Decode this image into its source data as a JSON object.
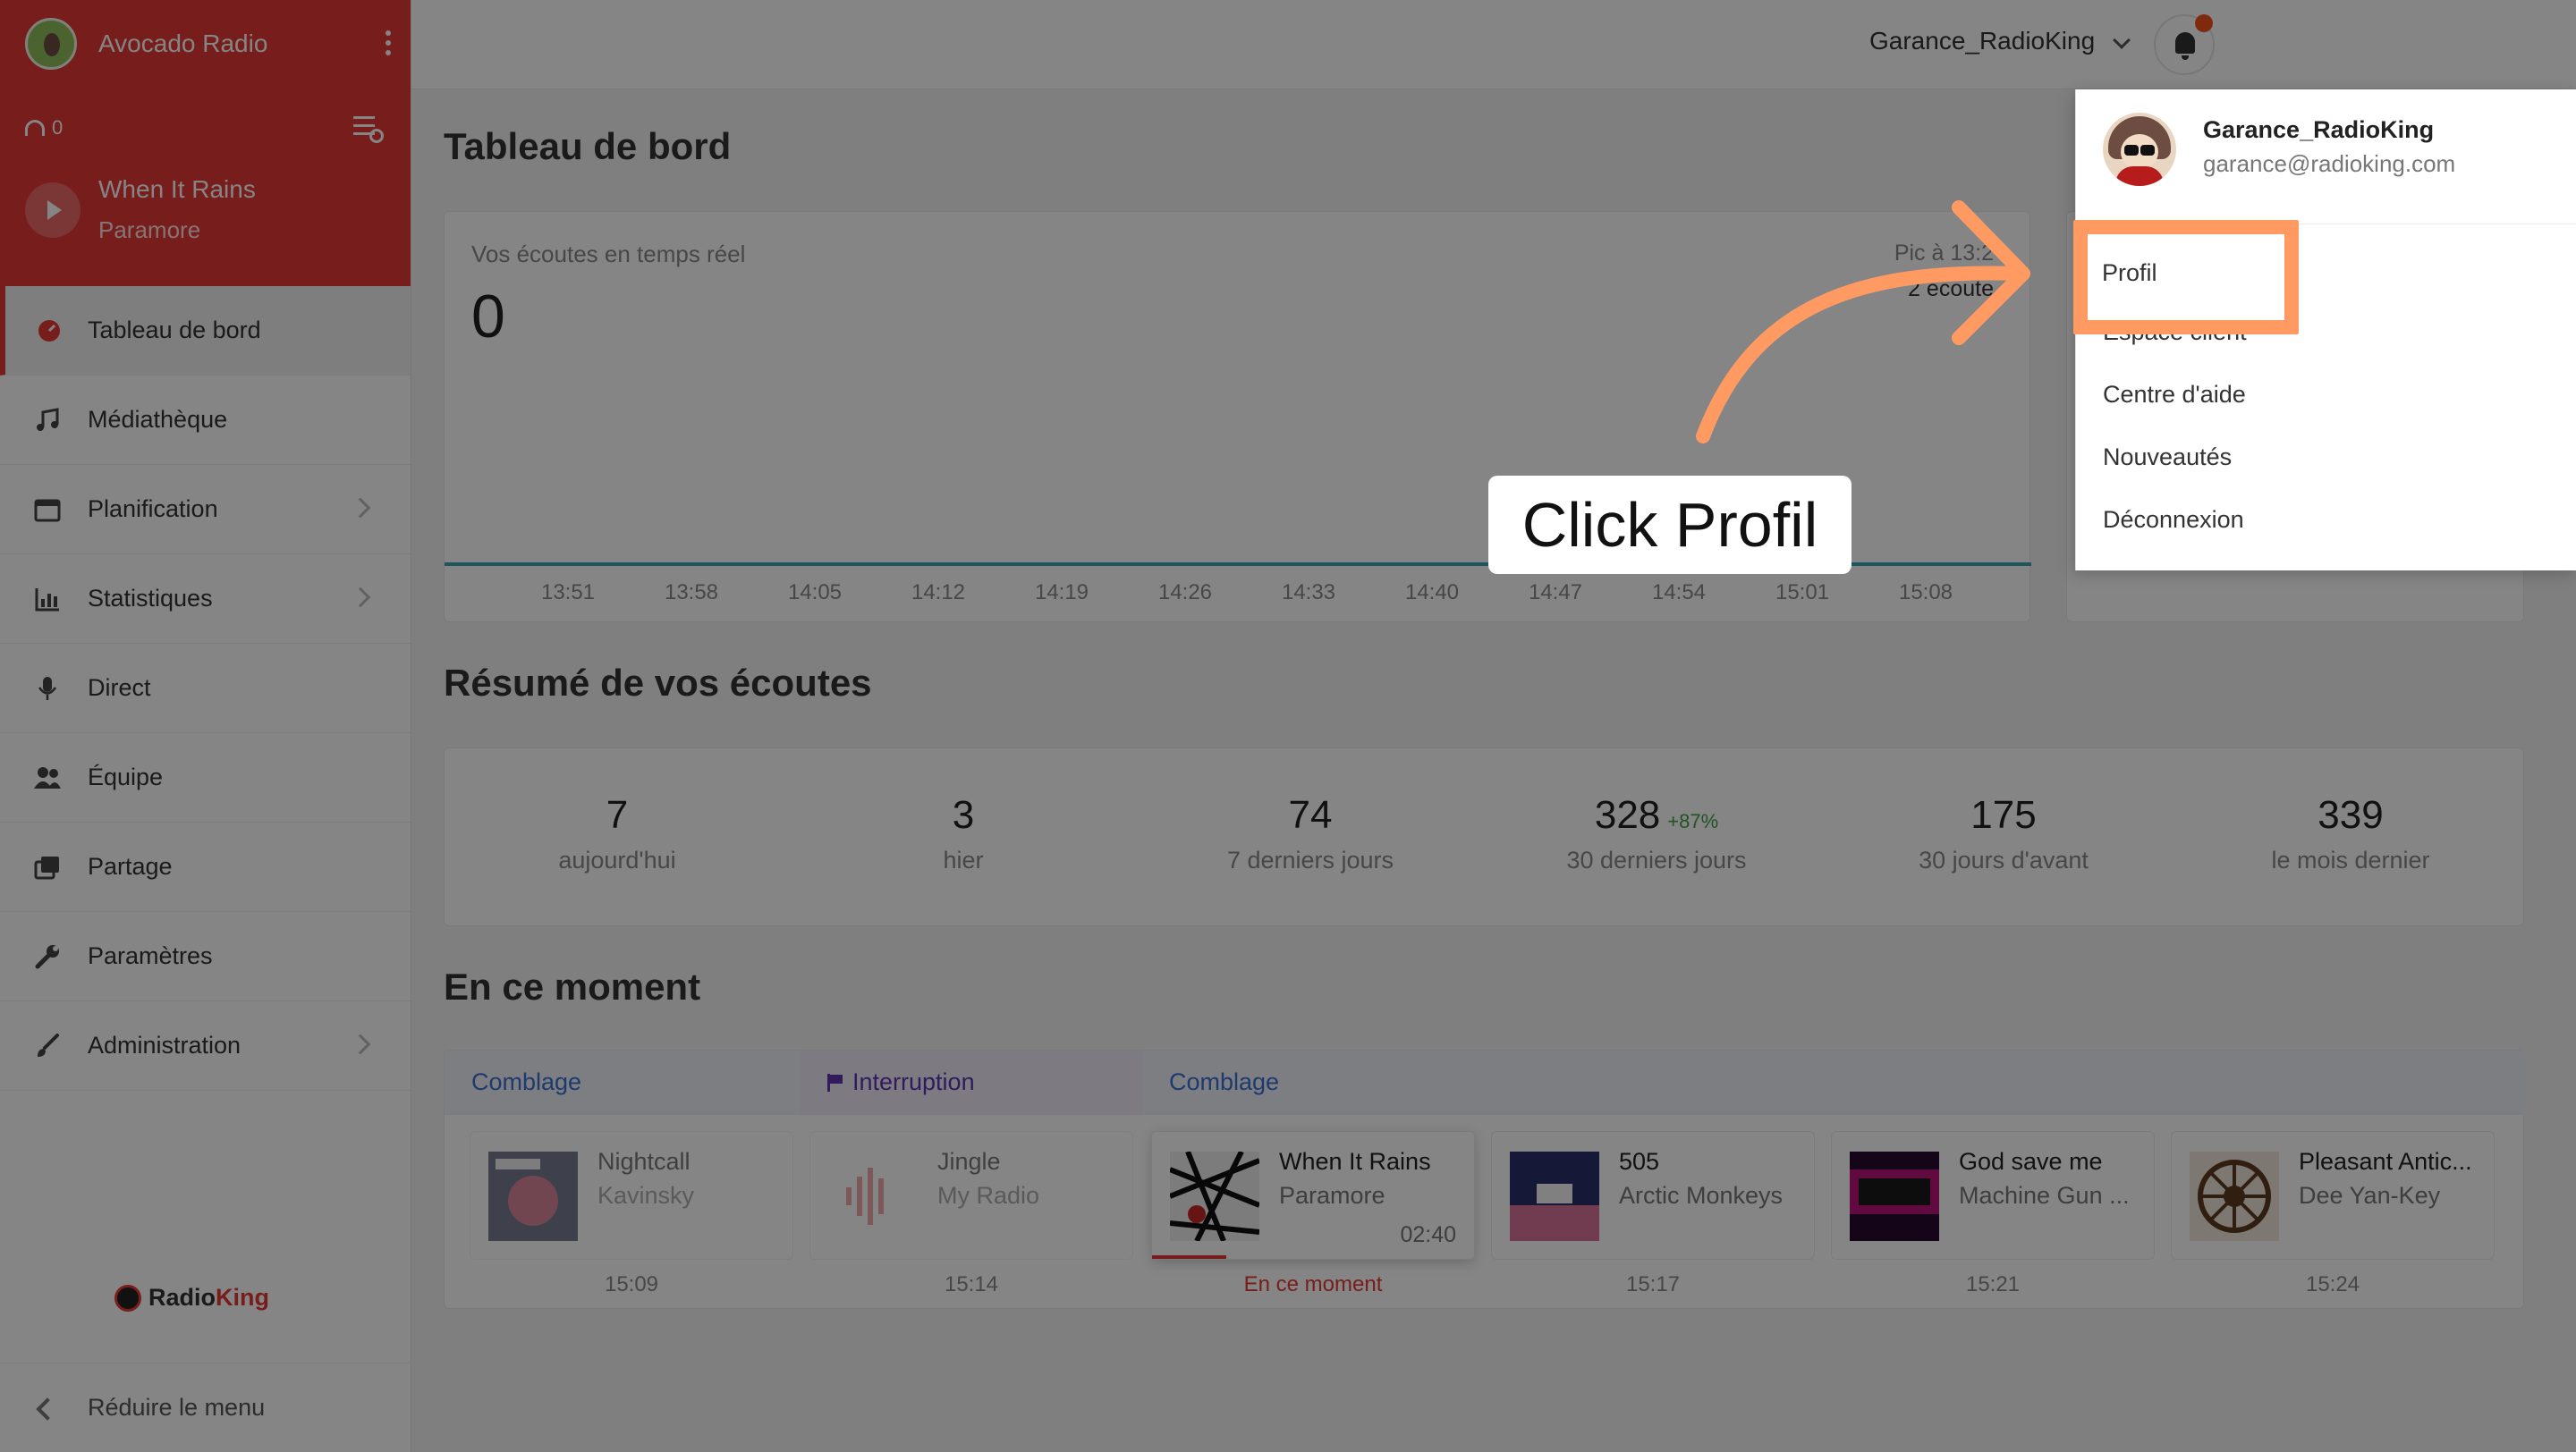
{
  "station": {
    "name": "Avocado Radio"
  },
  "player": {
    "listeners": "0",
    "track_title": "When It Rains",
    "track_artist": "Paramore"
  },
  "nav": [
    {
      "label": "Tableau de bord",
      "icon": "dashboard-icon",
      "active": true
    },
    {
      "label": "Médiathèque",
      "icon": "music-note-icon"
    },
    {
      "label": "Planification",
      "icon": "calendar-icon",
      "submenu": true
    },
    {
      "label": "Statistiques",
      "icon": "chart-icon",
      "submenu": true
    },
    {
      "label": "Direct",
      "icon": "microphone-icon"
    },
    {
      "label": "Équipe",
      "icon": "team-icon"
    },
    {
      "label": "Partage",
      "icon": "share-icon"
    },
    {
      "label": "Paramètres",
      "icon": "wrench-icon"
    },
    {
      "label": "Administration",
      "icon": "brush-icon",
      "submenu": true
    }
  ],
  "brand": {
    "logo_prefix": "Radio",
    "logo_suffix": "King"
  },
  "reduce_menu": "Réduire le menu",
  "topbar": {
    "username": "Garance_RadioKing"
  },
  "dashboard": {
    "title": "Tableau de bord",
    "realtime": {
      "label": "Vos écoutes en temps réel",
      "value": "0",
      "peak_label": "Pic à 13:2",
      "peak_value": "2 écoute",
      "ticks": [
        "13:51",
        "13:58",
        "14:05",
        "14:12",
        "14:19",
        "14:26",
        "14:33",
        "14:40",
        "14:47",
        "14:54",
        "15:01",
        "15:08"
      ]
    },
    "summary": {
      "title": "Résumé de vos écoutes",
      "stats": [
        {
          "value": "7",
          "label": "aujourd'hui"
        },
        {
          "value": "3",
          "label": "hier"
        },
        {
          "value": "74",
          "label": "7 derniers jours"
        },
        {
          "value": "328",
          "label": "30 derniers jours",
          "trend": "+87%"
        },
        {
          "value": "175",
          "label": "30 jours d'avant"
        },
        {
          "value": "339",
          "label": "le mois dernier"
        }
      ]
    },
    "now": {
      "title": "En ce moment",
      "labels": [
        "Comblage",
        "Interruption",
        "Comblage"
      ],
      "tracks": [
        {
          "title": "Nightcall",
          "artist": "Kavinsky",
          "time": "15:09"
        },
        {
          "title": "Jingle",
          "artist": "My Radio",
          "time": "15:14"
        },
        {
          "title": "When It Rains",
          "artist": "Paramore",
          "duration": "02:40",
          "time": "En ce moment",
          "progress": 0.23
        },
        {
          "title": "505",
          "artist": "Arctic Monkeys",
          "time": "15:17"
        },
        {
          "title": "God save me",
          "artist": "Machine Gun ...",
          "time": "15:21"
        },
        {
          "title": "Pleasant Antic...",
          "artist": "Dee Yan-Key",
          "time": "15:24"
        }
      ]
    }
  },
  "dropdown": {
    "name": "Garance_RadioKing",
    "email": "garance@radioking.com",
    "items": [
      "Profil",
      "Espace client",
      "Centre d'aide",
      "Nouveautés",
      "Déconnexion"
    ]
  },
  "annotation": {
    "text": "Click Profil",
    "color": "#ff9a62"
  },
  "colors": {
    "brand_red": "#e53935",
    "link_blue": "#3b6fd4",
    "line_teal": "#3aa6b9",
    "trend_green": "#43a047"
  }
}
